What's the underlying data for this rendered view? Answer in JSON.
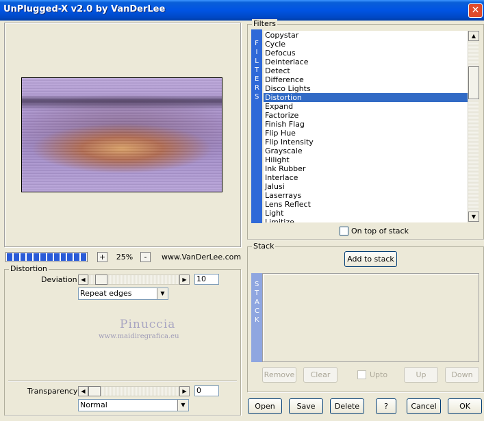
{
  "window": {
    "title": "UnPlugged-X v2.0 by VanDerLee",
    "close_glyph": "✕"
  },
  "preview": {
    "zoom_minus": "-",
    "zoom_plus": "+",
    "zoom_value": "25%",
    "website": "www.VanDerLee.com",
    "zoom_bar_cells": 12
  },
  "distortion": {
    "group_label": "Distortion",
    "deviation_label": "Deviation",
    "deviation_value": "10",
    "edge_mode": "Repeat edges"
  },
  "watermark": {
    "line1": "Pinuccia",
    "line2": "www.maidiregrafica.eu"
  },
  "transparency": {
    "label": "Transparency",
    "value": "0",
    "blend_mode": "Normal"
  },
  "filters": {
    "group_label": "Filters",
    "side_label": "F I L T E R S",
    "items": [
      "Copystar",
      "Cycle",
      "Defocus",
      "Deinterlace",
      "Detect",
      "Difference",
      "Disco Lights",
      "Distortion",
      "Expand",
      "Factorize",
      "Finish Flag",
      "Flip Hue",
      "Flip Intensity",
      "Grayscale",
      "Hilight",
      "Ink Rubber",
      "Interlace",
      "Jalusi",
      "Laserrays",
      "Lens Reflect",
      "Light",
      "Limitize"
    ],
    "selected": "Distortion",
    "on_top_label": "On top of stack"
  },
  "stack": {
    "group_label": "Stack",
    "side_label": "S T A C K",
    "add_button": "Add to stack",
    "remove_button": "Remove",
    "clear_button": "Clear",
    "upto_label": "Upto",
    "up_button": "Up",
    "down_button": "Down"
  },
  "footer": {
    "open": "Open",
    "save": "Save",
    "delete": "Delete",
    "help": "?",
    "cancel": "Cancel",
    "ok": "OK"
  },
  "colors": {
    "selection": "#316ac5",
    "side_bar": "#2f69d8",
    "title_bar": "#0054e3"
  }
}
